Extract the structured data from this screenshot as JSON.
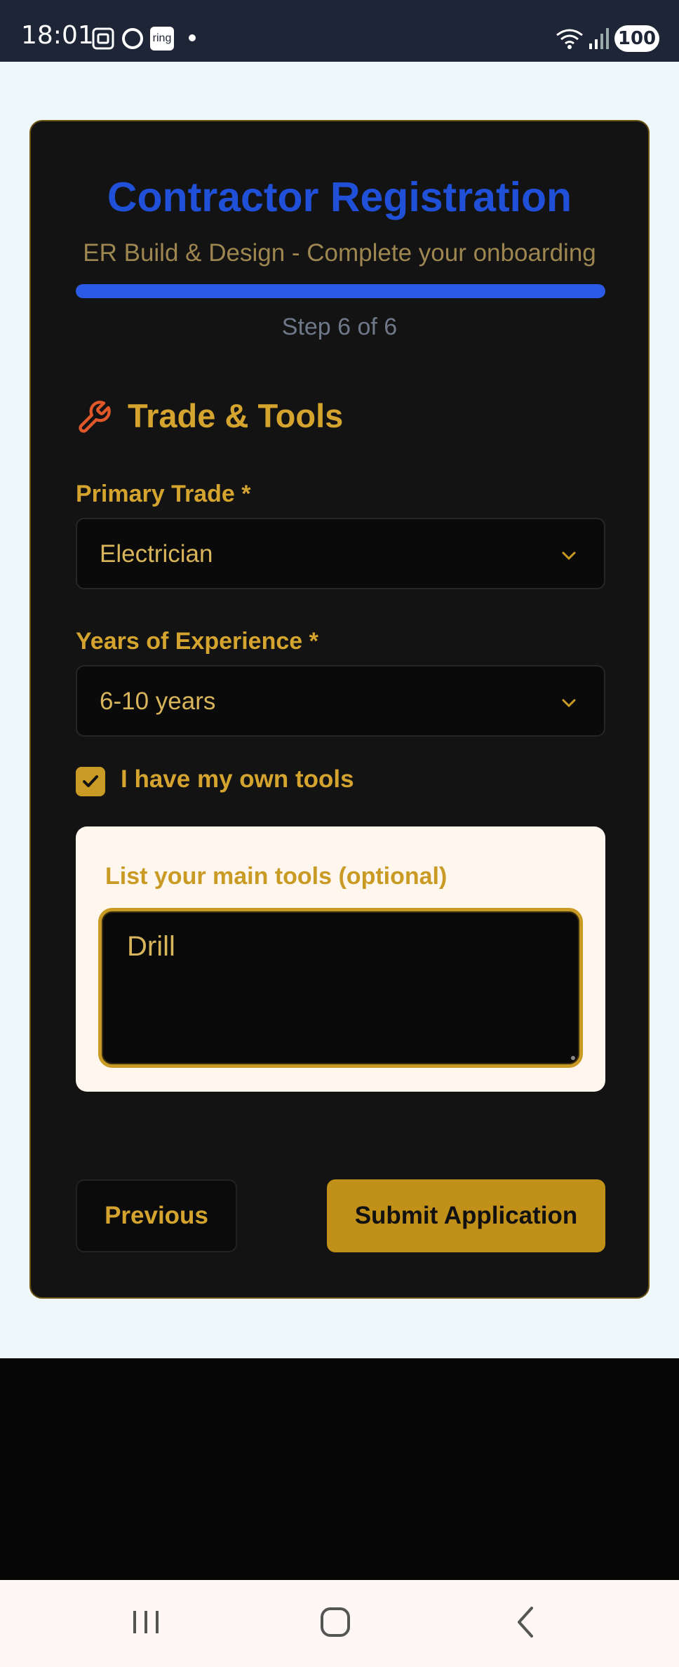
{
  "status_bar": {
    "time": "18:01",
    "battery": "100",
    "icons": [
      "screenshot-icon",
      "circle-app-icon",
      "ring-app-icon",
      "dot-icon",
      "wifi-icon",
      "signal-icon"
    ],
    "ring_label": "ring"
  },
  "header": {
    "title": "Contractor Registration",
    "subtitle": "ER Build & Design - Complete your onboarding",
    "progress_fraction": 1.0,
    "step_text": "Step 6 of 6"
  },
  "section": {
    "icon": "wrench-icon",
    "title": "Trade & Tools"
  },
  "fields": {
    "primary_trade": {
      "label": "Primary Trade *",
      "value": "Electrician"
    },
    "experience": {
      "label": "Years of Experience *",
      "value": "6-10 years"
    },
    "own_tools": {
      "label": "I have my own tools",
      "checked": true
    },
    "tools_list": {
      "label": "List your main tools (optional)",
      "value": "Drill"
    }
  },
  "buttons": {
    "previous": "Previous",
    "submit": "Submit Application"
  },
  "colors": {
    "accent_gold": "#d4a42e",
    "title_blue": "#2050d8",
    "progress_blue": "#2a5ae6",
    "card_bg": "#131313",
    "page_bg": "#eef7f9"
  },
  "nav_bar": {
    "icons": [
      "recent-apps-icon",
      "home-icon",
      "back-icon"
    ]
  }
}
